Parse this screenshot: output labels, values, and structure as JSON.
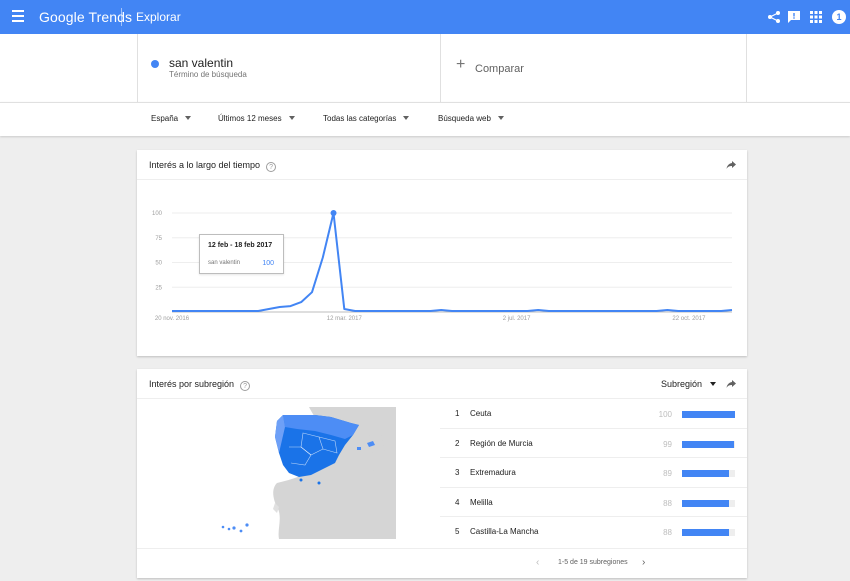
{
  "header": {
    "logo_google": "Google",
    "logo_trends": "Trends",
    "section": "Explorar",
    "notification_count": "1"
  },
  "search": {
    "term": "san valentin",
    "term_type": "Término de búsqueda",
    "compare_label": "Comparar"
  },
  "filters": [
    {
      "label": "España"
    },
    {
      "label": "Últimos 12 meses"
    },
    {
      "label": "Todas las categorías"
    },
    {
      "label": "Búsqueda web"
    }
  ],
  "interest_card": {
    "title": "Interés a lo largo del tiempo",
    "tooltip": {
      "date": "12 feb - 18 feb 2017",
      "term": "san valentin",
      "value": "100"
    }
  },
  "chart_data": {
    "type": "line",
    "yticks": [
      100,
      75,
      50,
      25
    ],
    "ylim": [
      0,
      100
    ],
    "xticks": [
      {
        "label": "20 nov. 2016",
        "week": 0
      },
      {
        "label": "12 mar. 2017",
        "week": 16
      },
      {
        "label": "2 jul. 2017",
        "week": 32
      },
      {
        "label": "22 oct. 2017",
        "week": 48
      }
    ],
    "series": [
      {
        "color": "#4285f4",
        "x": [
          0,
          1,
          2,
          3,
          4,
          5,
          6,
          7,
          8,
          9,
          10,
          11,
          12,
          13,
          14,
          15,
          16,
          17,
          18,
          19,
          20,
          21,
          22,
          23,
          24,
          25,
          26,
          27,
          28,
          29,
          30,
          31,
          32,
          33,
          34,
          35,
          36,
          37,
          38,
          39,
          40,
          41,
          42,
          43,
          44,
          45,
          46,
          47,
          48,
          49,
          50,
          51,
          52
        ],
        "values": [
          1,
          1,
          1,
          1,
          1,
          1,
          1,
          1,
          1,
          3,
          5,
          6,
          10,
          20,
          55,
          100,
          3,
          1,
          1,
          1,
          1,
          1,
          1,
          1,
          1,
          2,
          1,
          1,
          1,
          1,
          1,
          1,
          1,
          1,
          2,
          1,
          1,
          1,
          1,
          1,
          1,
          1,
          1,
          1,
          1,
          1,
          2,
          1,
          1,
          1,
          1,
          1,
          2
        ]
      }
    ],
    "highlight": {
      "x": 15,
      "value": 100
    }
  },
  "region_card": {
    "title": "Interés por subregión",
    "select_label": "Subregión",
    "rows": [
      {
        "rank": "1",
        "name": "Ceuta",
        "value": "100",
        "fraction": 1.0
      },
      {
        "rank": "2",
        "name": "Región de Murcia",
        "value": "99",
        "fraction": 0.99
      },
      {
        "rank": "3",
        "name": "Extremadura",
        "value": "89",
        "fraction": 0.89
      },
      {
        "rank": "4",
        "name": "Melilla",
        "value": "88",
        "fraction": 0.88
      },
      {
        "rank": "5",
        "name": "Castilla-La Mancha",
        "value": "88",
        "fraction": 0.88
      }
    ],
    "pagination": "1-5 de 19 subregiones"
  },
  "colors": {
    "brand": "#4285f4",
    "region_fill_strong": "#1a73e8",
    "land": "#d5d5d5"
  }
}
